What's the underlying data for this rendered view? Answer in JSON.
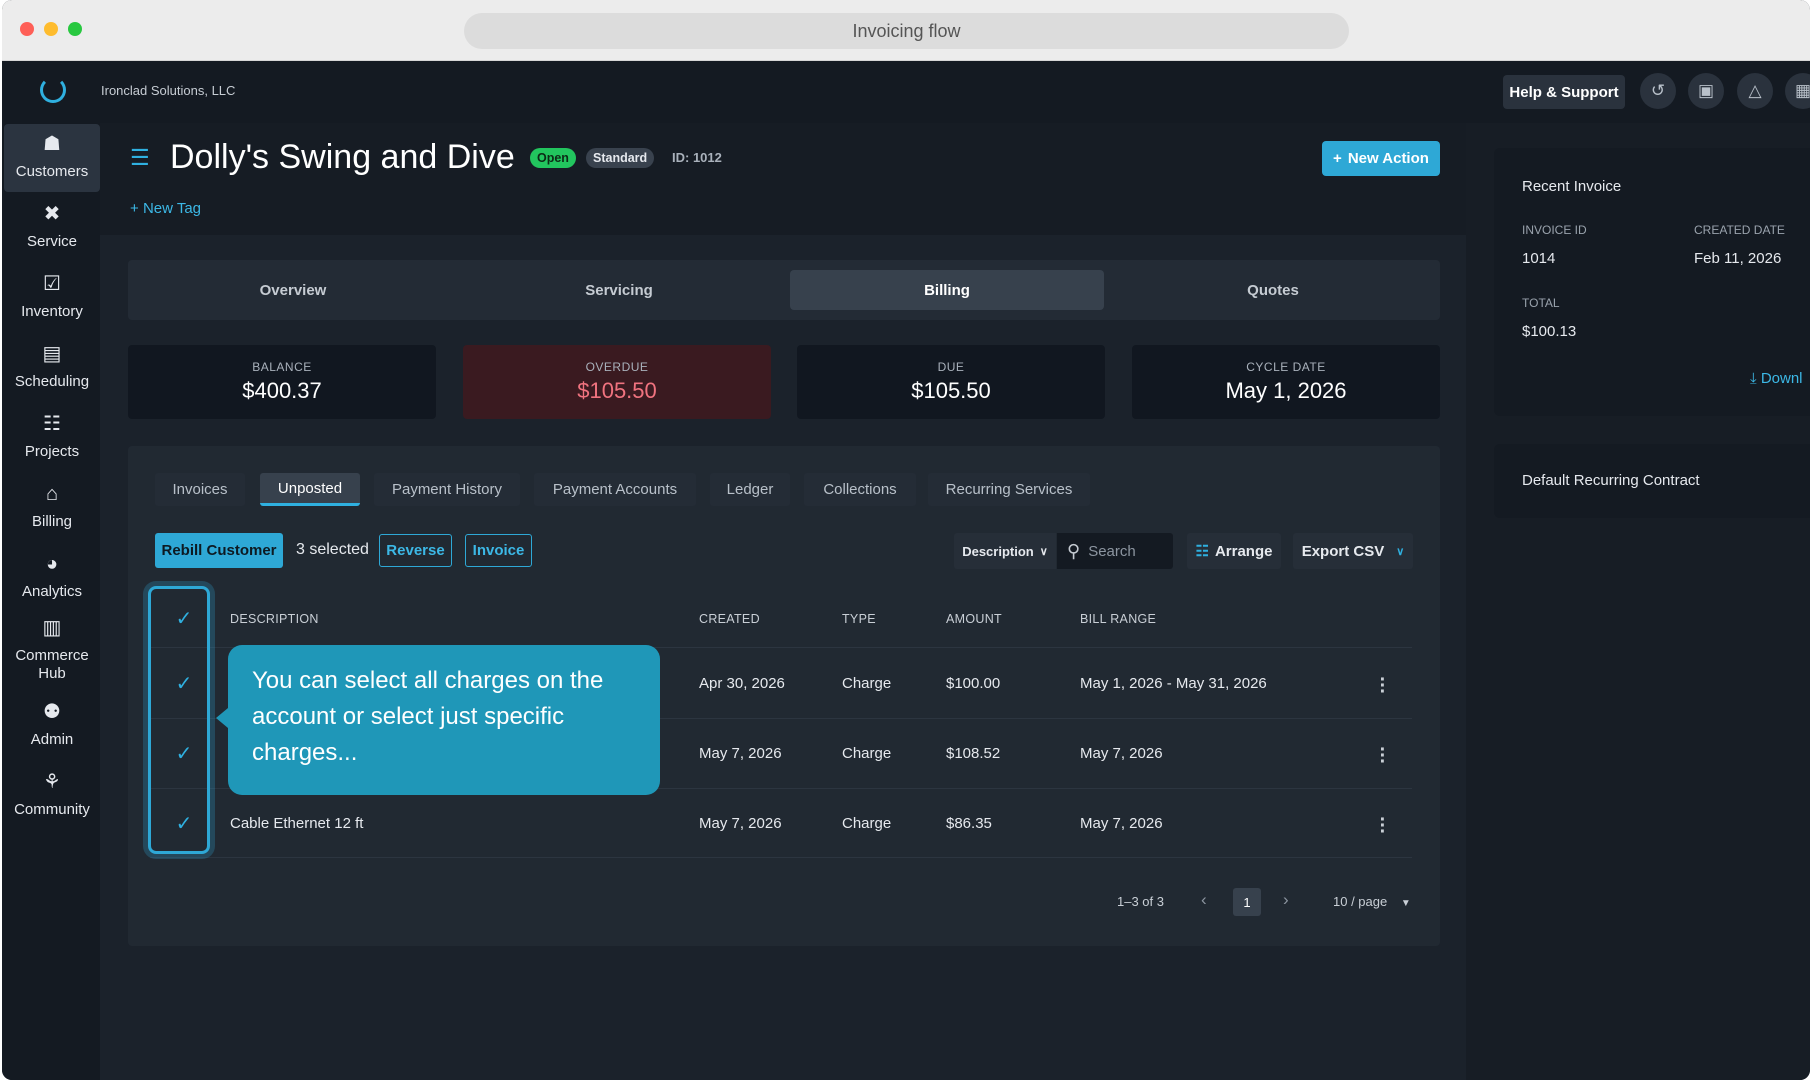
{
  "browser": {
    "title": "Invoicing flow"
  },
  "topbar": {
    "company": "Ironclad Solutions, LLC",
    "help_label": "Help & Support",
    "icons": [
      "history-icon",
      "calendar-icon",
      "bell-icon",
      "apps-icon"
    ]
  },
  "sidebar": {
    "items": [
      {
        "label": "Customers",
        "icon": "customers-icon",
        "active": true
      },
      {
        "label": "Service",
        "icon": "tools-icon"
      },
      {
        "label": "Inventory",
        "icon": "clipboard-icon"
      },
      {
        "label": "Scheduling",
        "icon": "calendar-icon"
      },
      {
        "label": "Projects",
        "icon": "hierarchy-icon"
      },
      {
        "label": "Billing",
        "icon": "bank-icon"
      },
      {
        "label": "Analytics",
        "icon": "pie-chart-icon"
      },
      {
        "label": "Commerce Hub",
        "icon": "store-icon"
      },
      {
        "label": "Admin",
        "icon": "admin-icon"
      },
      {
        "label": "Community",
        "icon": "community-icon"
      }
    ]
  },
  "customer": {
    "name": "Dolly's Swing and Dive",
    "status": "Open",
    "tier": "Standard",
    "id_label": "ID: 1012",
    "new_tag": "New Tag",
    "new_action": "New Action"
  },
  "tabs": [
    {
      "label": "Overview"
    },
    {
      "label": "Servicing"
    },
    {
      "label": "Billing",
      "active": true
    },
    {
      "label": "Quotes"
    }
  ],
  "stats": [
    {
      "label": "BALANCE",
      "value": "$400.37"
    },
    {
      "label": "OVERDUE",
      "value": "$105.50"
    },
    {
      "label": "DUE",
      "value": "$105.50"
    },
    {
      "label": "CYCLE DATE",
      "value": "May 1, 2026"
    }
  ],
  "subtabs": [
    {
      "label": "Invoices"
    },
    {
      "label": "Unposted",
      "active": true
    },
    {
      "label": "Payment History"
    },
    {
      "label": "Payment Accounts"
    },
    {
      "label": "Ledger"
    },
    {
      "label": "Collections"
    },
    {
      "label": "Recurring Services"
    }
  ],
  "toolbar": {
    "rebill": "Rebill Customer",
    "selected": "3 selected",
    "reverse": "Reverse",
    "invoice": "Invoice",
    "filter_field": "Description",
    "search_placeholder": "Search",
    "arrange": "Arrange",
    "export": "Export CSV"
  },
  "table": {
    "headers": [
      "DESCRIPTION",
      "CREATED",
      "TYPE",
      "AMOUNT",
      "BILL RANGE"
    ],
    "rows": [
      {
        "description": "",
        "created": "Apr 30, 2026",
        "type": "Charge",
        "amount": "$100.00",
        "bill_range": "May 1, 2026 - May 31, 2026"
      },
      {
        "description": "",
        "created": "May 7, 2026",
        "type": "Charge",
        "amount": "$108.52",
        "bill_range": "May 7, 2026"
      },
      {
        "description": "Cable Ethernet 12 ft",
        "created": "May 7, 2026",
        "type": "Charge",
        "amount": "$86.35",
        "bill_range": "May 7, 2026"
      }
    ]
  },
  "tooltip": {
    "text": "You can select all charges on the account or select just specific charges..."
  },
  "pagination": {
    "range": "1–3 of 3",
    "page": "1",
    "per_page": "10 / page"
  },
  "right_panel": {
    "recent_title": "Recent Invoice",
    "invoice_id_label": "INVOICE ID",
    "invoice_id": "1014",
    "created_label": "CREATED DATE",
    "created": "Feb 11, 2026",
    "total_label": "TOTAL",
    "total": "$100.13",
    "download": "Downl",
    "contract_title": "Default Recurring Contract"
  },
  "colors": {
    "accent": "#2ea8d6",
    "open_badge": "#22c55e",
    "overdue_bg": "#3a1a20",
    "overdue_text": "#f0737f",
    "tooltip_bg": "#1f97b8"
  }
}
